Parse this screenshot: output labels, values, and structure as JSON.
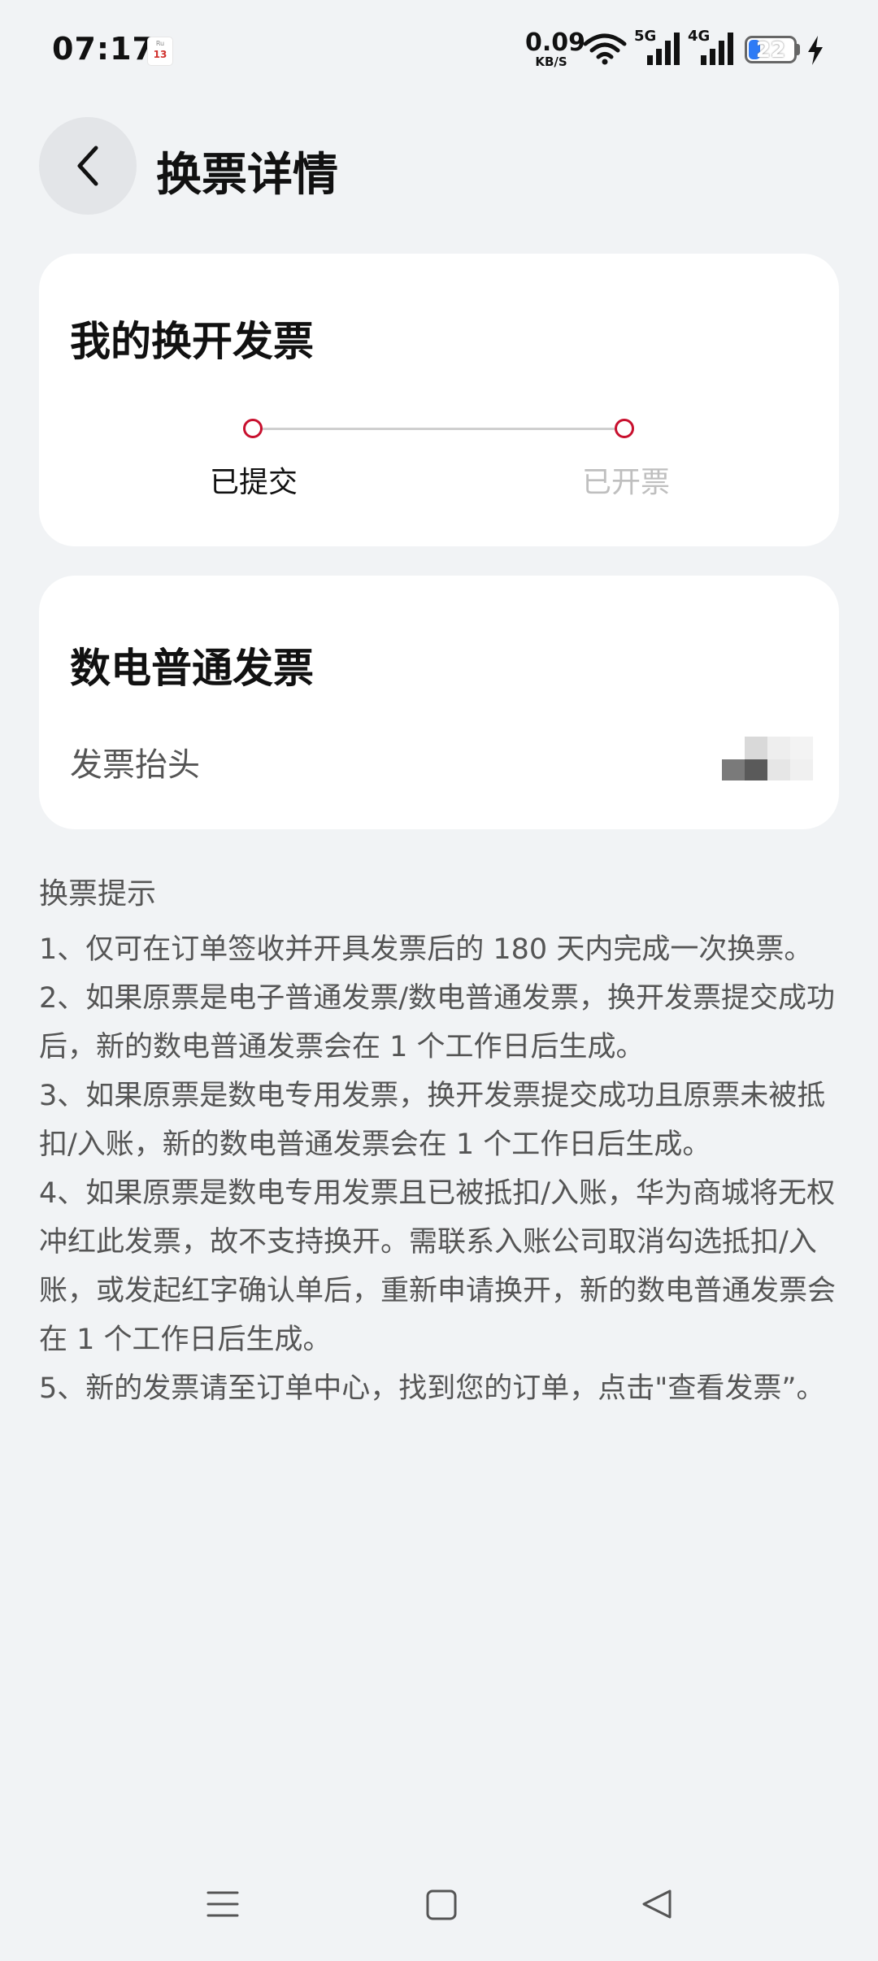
{
  "status_bar": {
    "time": "07:17",
    "calendar_top": "Ru",
    "calendar_day": "13",
    "net_speed_value": "0.09",
    "net_speed_unit": "KB/S",
    "signal_5g": "5G",
    "signal_4g": "4G",
    "battery_level": "22"
  },
  "header": {
    "title": "换票详情"
  },
  "progress_card": {
    "title": "我的换开发票",
    "steps": [
      {
        "label": "已提交",
        "active": true
      },
      {
        "label": "已开票",
        "active": false
      }
    ]
  },
  "invoice_card": {
    "title": "数电普通发票",
    "field_label": "发票抬头"
  },
  "tips": {
    "title": "换票提示",
    "items": [
      "1、仅可在订单签收并开具发票后的 180 天内完成一次换票。",
      "2、如果原票是电子普通发票/数电普通发票，换开发票提交成功后，新的数电普通发票会在 1 个工作日后生成。",
      "3、如果原票是数电专用发票，换开发票提交成功且原票未被抵扣/入账，新的数电普通发票会在 1 个工作日后生成。",
      "4、如果原票是数电专用发票且已被抵扣/入账，华为商城将无权冲红此发票，故不支持换开。需联系入账公司取消勾选抵扣/入账，或发起红字确认单后，重新申请换开，新的数电普通发票会在 1 个工作日后生成。",
      "5、新的发票请至订单中心，找到您的订单，点击\"查看发票”。"
    ]
  },
  "colors": {
    "background": "#f1f3f5",
    "card": "#ffffff",
    "accent": "#c8102e",
    "text_primary": "#111111",
    "text_secondary": "#555555",
    "text_disabled": "#bfbfbf"
  }
}
